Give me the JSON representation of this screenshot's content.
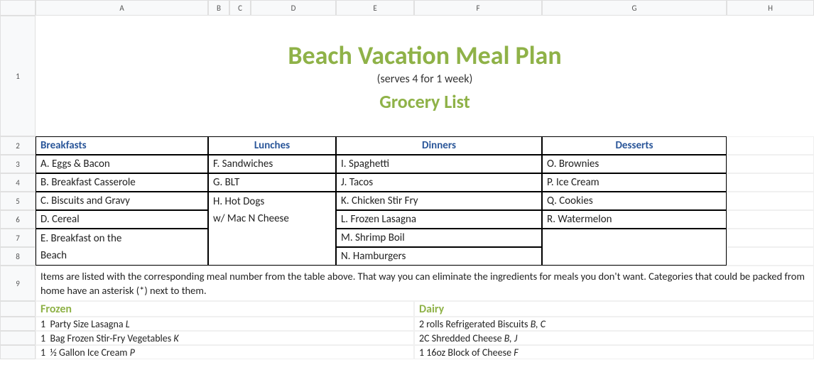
{
  "columns": [
    "A",
    "B",
    "C",
    "D",
    "E",
    "F",
    "G",
    "H"
  ],
  "rows": [
    "1",
    "2",
    "3",
    "4",
    "5",
    "6",
    "7",
    "8",
    "9"
  ],
  "title": {
    "main": "Beach Vacation Meal Plan",
    "sub": "(serves 4 for 1 week)",
    "secondary": "Grocery List"
  },
  "meal_headers": {
    "breakfasts": "Breakfasts",
    "lunches": "Lunches",
    "dinners": "Dinners",
    "desserts": "Desserts"
  },
  "meals": {
    "breakfasts": [
      "A. Eggs & Bacon",
      "B. Breakfast Casserole",
      "C. Biscuits and Gravy",
      "D. Cereal",
      "E. Breakfast on the",
      "Beach"
    ],
    "lunches": [
      "F. Sandwiches",
      "G. BLT",
      "H. Hot Dogs",
      "w/ Mac N Cheese"
    ],
    "dinners": [
      "I. Spaghetti",
      "J. Tacos",
      "K. Chicken Stir Fry",
      "L. Frozen Lasagna",
      "M. Shrimp Boil",
      "N. Hamburgers"
    ],
    "desserts": [
      "O. Brownies",
      "P. Ice Cream",
      "Q. Cookies",
      "R. Watermelon"
    ]
  },
  "note": "Items are listed with the corresponding meal number from the table above. That way you can eliminate the ingredients for meals you don't want. Categories that could be packed from home have an asterisk (*) next to them.",
  "grocery": {
    "frozen": {
      "header": "Frozen",
      "items": [
        {
          "qty": "1",
          "desc": "Party Size Lasagna",
          "ref": "L"
        },
        {
          "qty": "1",
          "desc": "Bag Frozen Stir-Fry Vegetables",
          "ref": "K"
        },
        {
          "qty": "1",
          "desc": "½ Gallon Ice Cream",
          "ref": "P"
        }
      ]
    },
    "dairy": {
      "header": "Dairy",
      "items": [
        {
          "qty": "2 rolls",
          "desc": "Refrigerated Biscuits",
          "ref": "B, C"
        },
        {
          "qty": "2C",
          "desc": "Shredded Cheese",
          "ref": "B, J"
        },
        {
          "qty": "1",
          "desc": "16oz Block of Cheese",
          "ref": "F"
        }
      ]
    }
  }
}
